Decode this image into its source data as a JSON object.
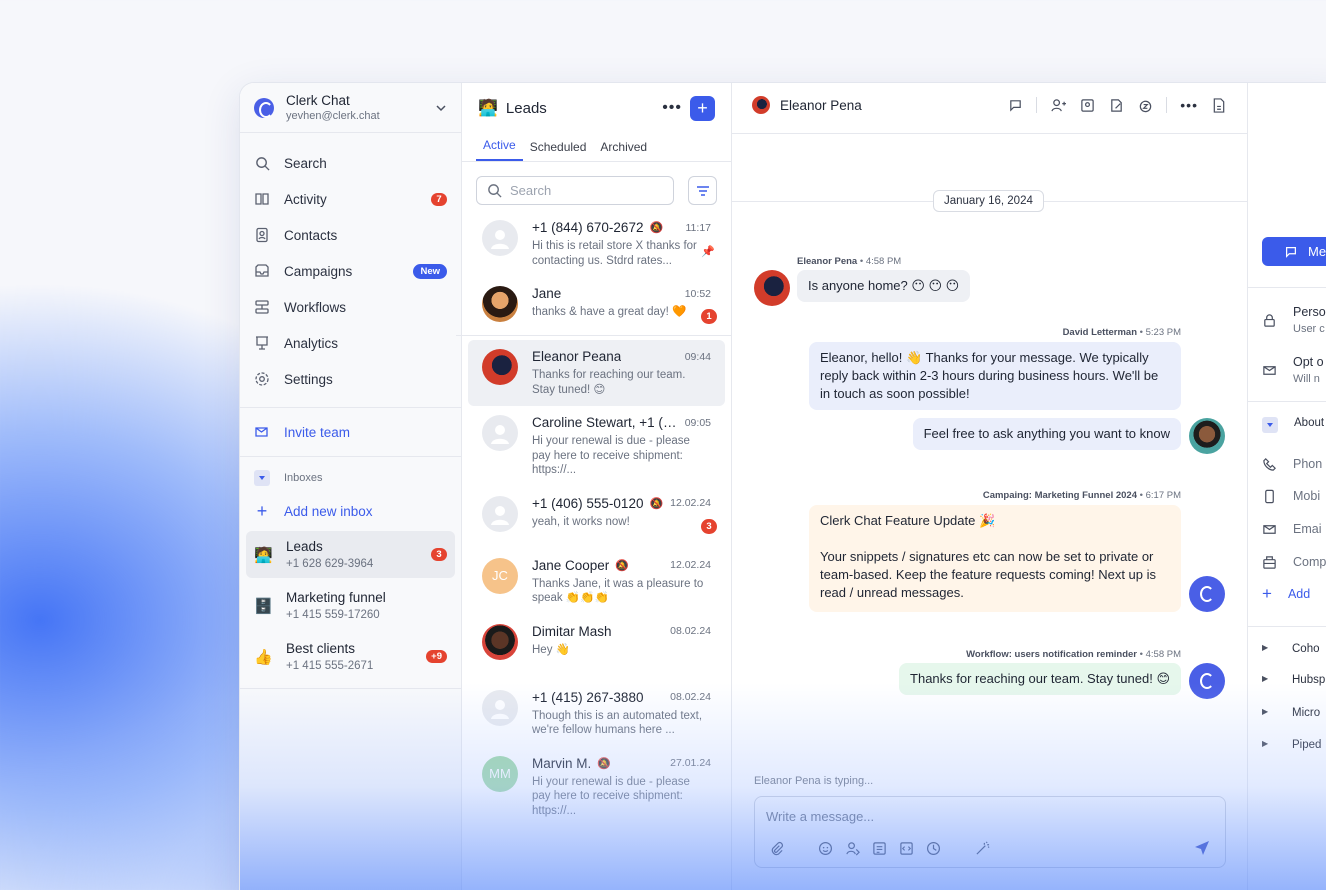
{
  "workspace": {
    "name": "Clerk Chat",
    "email": "yevhen@clerk.chat"
  },
  "nav": [
    {
      "icon": "search-icon",
      "label": "Search",
      "badge": ""
    },
    {
      "icon": "activity-icon",
      "label": "Activity",
      "badge": "7"
    },
    {
      "icon": "contacts-icon",
      "label": "Contacts",
      "badge": ""
    },
    {
      "icon": "campaigns-icon",
      "label": "Campaigns",
      "badge": "New"
    },
    {
      "icon": "workflows-icon",
      "label": "Workflows",
      "badge": ""
    },
    {
      "icon": "analytics-icon",
      "label": "Analytics",
      "badge": ""
    },
    {
      "icon": "settings-icon",
      "label": "Settings",
      "badge": ""
    }
  ],
  "invite_label": "Invite team",
  "inboxes_label": "Inboxes",
  "add_inbox_label": "Add new inbox",
  "inboxes": [
    {
      "emoji": "🧑‍💻",
      "name": "Leads",
      "number": "+1 628 629-3964",
      "badge": "3"
    },
    {
      "emoji": "🗄️",
      "name": "Marketing funnel",
      "number": "+1 415 559-17260",
      "badge": ""
    },
    {
      "emoji": "👍",
      "name": "Best clients",
      "number": "+1 415 555-2671",
      "badge": "+9"
    }
  ],
  "list": {
    "emoji": "🧑‍💻",
    "title": "Leads",
    "tabs": [
      "Active",
      "Scheduled",
      "Archived"
    ],
    "search_placeholder": "Search",
    "conversations": [
      {
        "name": "+1 (844) 670-2672",
        "time": "11:17",
        "preview": "Hi this is retail store X thanks for contacting us. Stdrd rates...",
        "badge": "",
        "initials": ""
      },
      {
        "name": "Jane",
        "time": "10:52",
        "preview": "thanks & have a great day! 🧡",
        "badge": "1",
        "initials": ""
      },
      {
        "name": "Eleanor Peana",
        "time": "09:44",
        "preview": "Thanks for reaching our team. Stay tuned! 😊",
        "badge": "",
        "initials": ""
      },
      {
        "name": "Caroline Stewart, +1 (54...",
        "time": "09:05",
        "preview": "Hi your renewal is due - please pay here to receive shipment: https://...",
        "badge": "",
        "initials": ""
      },
      {
        "name": "+1 (406) 555-0120",
        "time": "12.02.24",
        "preview": "yeah, it works now!",
        "badge": "3",
        "initials": ""
      },
      {
        "name": "Jane Cooper",
        "time": "12.02.24",
        "preview": "Thanks Jane, it was a pleasure to speak 👏👏👏",
        "badge": "",
        "initials": "JC"
      },
      {
        "name": "Dimitar Mash",
        "time": "08.02.24",
        "preview": "Hey 👋",
        "badge": "",
        "initials": ""
      },
      {
        "name": "+1 (415) 267-3880",
        "time": "08.02.24",
        "preview": "Though this is an automated text, we're fellow humans here ...",
        "badge": "",
        "initials": ""
      },
      {
        "name": "Marvin M.",
        "time": "27.01.24",
        "preview": "Hi your renewal is due - please pay here to receive shipment: https://...",
        "badge": "",
        "initials": "MM"
      }
    ]
  },
  "chat": {
    "contact": "Eleanor Pena",
    "date": "January 16, 2024",
    "messages": [
      {
        "author": "Eleanor Pena",
        "time": "4:58 PM",
        "text": "Is anyone home? 😶 😶 😶"
      },
      {
        "author": "David Letterman",
        "time": "5:23 PM",
        "text": "Eleanor, hello! 👋 Thanks for your message. We typically reply back within 2-3 hours during business hours. We'll be in touch as soon possible!"
      },
      {
        "author": "",
        "time": "",
        "text": "Feel free to ask anything you want to know"
      },
      {
        "author": "Campaing: Marketing Funnel 2024",
        "time": "6:17 PM",
        "text": "Clerk Chat Feature Update 🎉",
        "text2": "Your snippets / signatures etc can now be set to private or team-based. Keep the feature requests coming! Next up is read / unread messages."
      },
      {
        "author": "Workflow: users notification reminder",
        "time": "4:58 PM",
        "text": "Thanks for reaching our team. Stay tuned! 😊"
      }
    ],
    "typing": "Eleanor Pena is typing...",
    "composer_placeholder": "Write a message..."
  },
  "details": {
    "button_label": "Me",
    "rows": [
      {
        "title": "Perso",
        "sub": "User c"
      },
      {
        "title": "Opt o",
        "sub": "Will n"
      }
    ],
    "about_label": "About",
    "fields": [
      "Phon",
      "Mobi",
      "Emai",
      "Comp",
      "Add"
    ],
    "integrations": [
      "Coho",
      "Hubsp",
      "Micro",
      "Piped"
    ]
  },
  "colors": {
    "accent": "#3b5bea",
    "badge": "#e5432f"
  }
}
